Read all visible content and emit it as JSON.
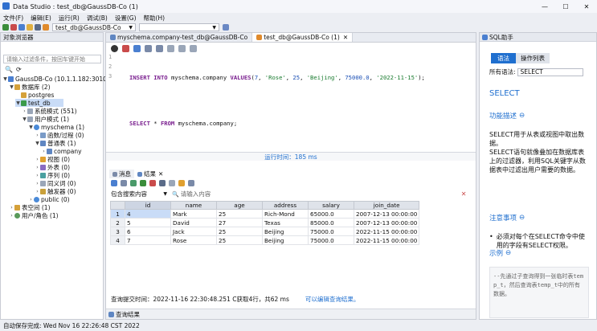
{
  "window": {
    "title": "Data Studio : test_db@GaussDB-Co (1)",
    "buttons": [
      "—",
      "☐",
      "✕"
    ]
  },
  "menu": [
    "文件(F)",
    "编辑(E)",
    "运行(R)",
    "调试(B)",
    "设置(G)",
    "帮助(H)"
  ],
  "toolbar": {
    "connection": "test_db@GaussDB-Co"
  },
  "left_panel": {
    "title": "对象浏览器",
    "filter_placeholder": "请输入过滤条件，按回车键开始",
    "tree": [
      {
        "label": "GaussDB-Co (10.1.1.182:3010",
        "indent": 0,
        "arrow": "▼"
      },
      {
        "label": "数据库 (2)",
        "indent": 1,
        "arrow": "▼"
      },
      {
        "label": "postgres",
        "indent": 2,
        "arrow": ""
      },
      {
        "label": "test_db",
        "indent": 2,
        "arrow": "▼",
        "selected": true
      },
      {
        "label": "系统模式 (551)",
        "indent": 3,
        "arrow": "›"
      },
      {
        "label": "用户模式 (1)",
        "indent": 3,
        "arrow": "▼"
      },
      {
        "label": "myschema (1)",
        "indent": 4,
        "arrow": "▼"
      },
      {
        "label": "函数/过程 (0)",
        "indent": 5,
        "arrow": "›"
      },
      {
        "label": "普通表 (1)",
        "indent": 5,
        "arrow": "▼"
      },
      {
        "label": "company",
        "indent": 6,
        "arrow": "›"
      },
      {
        "label": "视图 (0)",
        "indent": 5,
        "arrow": "›"
      },
      {
        "label": "外表 (0)",
        "indent": 5,
        "arrow": "›"
      },
      {
        "label": "序列 (0)",
        "indent": 5,
        "arrow": "›"
      },
      {
        "label": "同义词 (0)",
        "indent": 5,
        "arrow": "›"
      },
      {
        "label": "触发器 (0)",
        "indent": 5,
        "arrow": "›"
      },
      {
        "label": "public (0)",
        "indent": 4,
        "arrow": "›"
      },
      {
        "label": "表空间 (1)",
        "indent": 1,
        "arrow": "›"
      },
      {
        "label": "用户/角色 (1)",
        "indent": 1,
        "arrow": "›"
      }
    ]
  },
  "editor": {
    "tabs": [
      "myschema.company-test_db@GaussDB-Co",
      "test_db@GaussDB-Co (1)"
    ],
    "line_numbers": [
      "1",
      "2",
      "3"
    ],
    "sql_insert": {
      "kw1": "INSERT",
      "kw2": "INTO",
      "target": "myschema.company",
      "kw3": "VALUES",
      "v1": "7",
      "v2": "'Rose'",
      "v3": "25",
      "v4": "'Beijing'",
      "v5": "75000.0",
      "v6": "'2022-11-15'"
    },
    "sql_select": {
      "kw1": "SELECT",
      "star": "*",
      "kw2": "FROM",
      "target": "myschema.company;"
    },
    "exec_time": "运行时间：185 ms"
  },
  "results": {
    "tabs": [
      "消息",
      "结果"
    ],
    "filter_options": "包含搜索内容",
    "search_placeholder": "请输入内容",
    "columns": [
      "",
      "id",
      "name",
      "age",
      "address",
      "salary",
      "join_date"
    ],
    "rows": [
      [
        "1",
        "4",
        "Mark",
        "25",
        "Rich-Mond",
        "65000.0",
        "2007-12-13 00:00:00"
      ],
      [
        "2",
        "5",
        "David",
        "27",
        "Texas",
        "85000.0",
        "2007-12-13 00:00:00"
      ],
      [
        "3",
        "6",
        "Jack",
        "25",
        "Beijing",
        "75000.0",
        "2022-11-15 00:00:00"
      ],
      [
        "4",
        "7",
        "Rose",
        "25",
        "Beijing",
        "75000.0",
        "2022-11-15 00:00:00"
      ]
    ],
    "status": "查询提交时间：2022-11-16 22:30:48.251 C获取4行，共62 ms",
    "status_link": "可以编辑查询结果。",
    "bottom_tab": "查询结果"
  },
  "right_panel": {
    "title": "SQL助手",
    "tabs": [
      "语法",
      "操作列表"
    ],
    "syntax_label": "所有语法:",
    "syntax_value": "SELECT",
    "heading": "SELECT",
    "section_desc": "功能描述",
    "desc_text": "SELECT用于从表或视图中取出数据。\nSELECT语句就像叠加在数据库表上的过滤器，利用SQL关键字从数据表中过滤出用户需要的数据。",
    "section_notes": "注意事项",
    "note_text": "必须对每个在SELECT命令中使用的字段有SELECT权限。",
    "section_example": "示例",
    "example_text": "--先通过子查询得到一张临时表temp_t，然后查询表temp_t中的所有数据。"
  },
  "status": {
    "autosave": "自动保存完成:  Wed Nov 16 22:26:48 CST 2022"
  },
  "colors": {
    "accent": "#1f6fcf",
    "keyword": "#7a1f8f",
    "string": "#1a7b2f"
  }
}
